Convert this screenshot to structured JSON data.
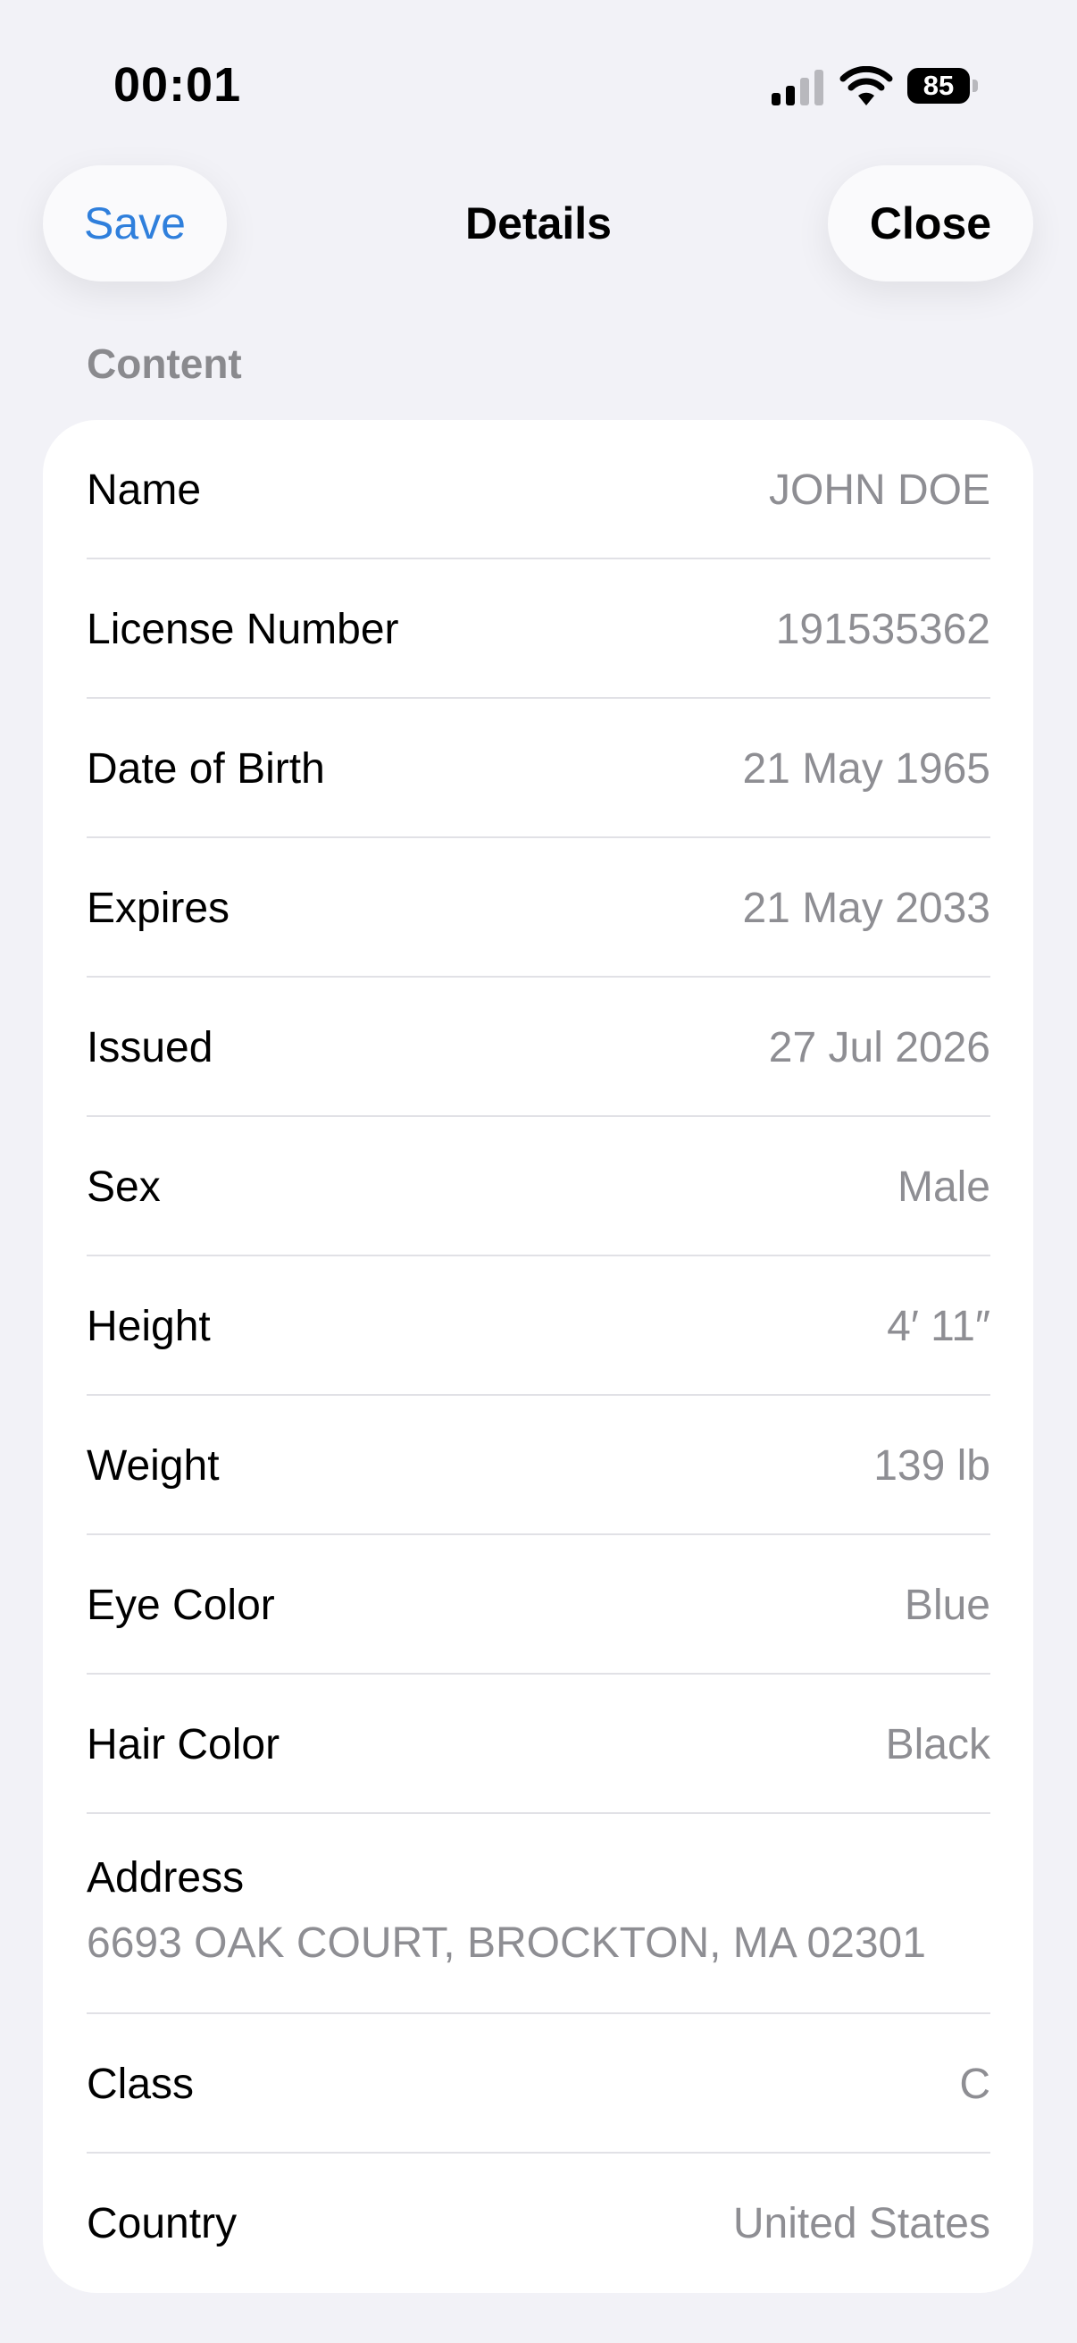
{
  "status_bar": {
    "time": "00:01",
    "battery": "85"
  },
  "nav": {
    "save_label": "Save",
    "title": "Details",
    "close_label": "Close"
  },
  "section": {
    "header": "Content"
  },
  "rows": [
    {
      "label": "Name",
      "value": "JOHN DOE"
    },
    {
      "label": "License Number",
      "value": "191535362"
    },
    {
      "label": "Date of Birth",
      "value": "21 May 1965"
    },
    {
      "label": "Expires",
      "value": "21 May 2033"
    },
    {
      "label": "Issued",
      "value": "27 Jul 2026"
    },
    {
      "label": "Sex",
      "value": "Male"
    },
    {
      "label": "Height",
      "value": "4′ 11″"
    },
    {
      "label": "Weight",
      "value": "139 lb"
    },
    {
      "label": "Eye Color",
      "value": "Blue"
    },
    {
      "label": "Hair Color",
      "value": "Black"
    },
    {
      "label": "Address",
      "value": "6693 OAK COURT, BROCKTON, MA 02301"
    },
    {
      "label": "Class",
      "value": "C"
    },
    {
      "label": "Country",
      "value": "United States"
    }
  ],
  "colors": {
    "accent": "#2f7fdc",
    "background": "#f2f2f7",
    "secondary_text": "#8e8e93"
  }
}
